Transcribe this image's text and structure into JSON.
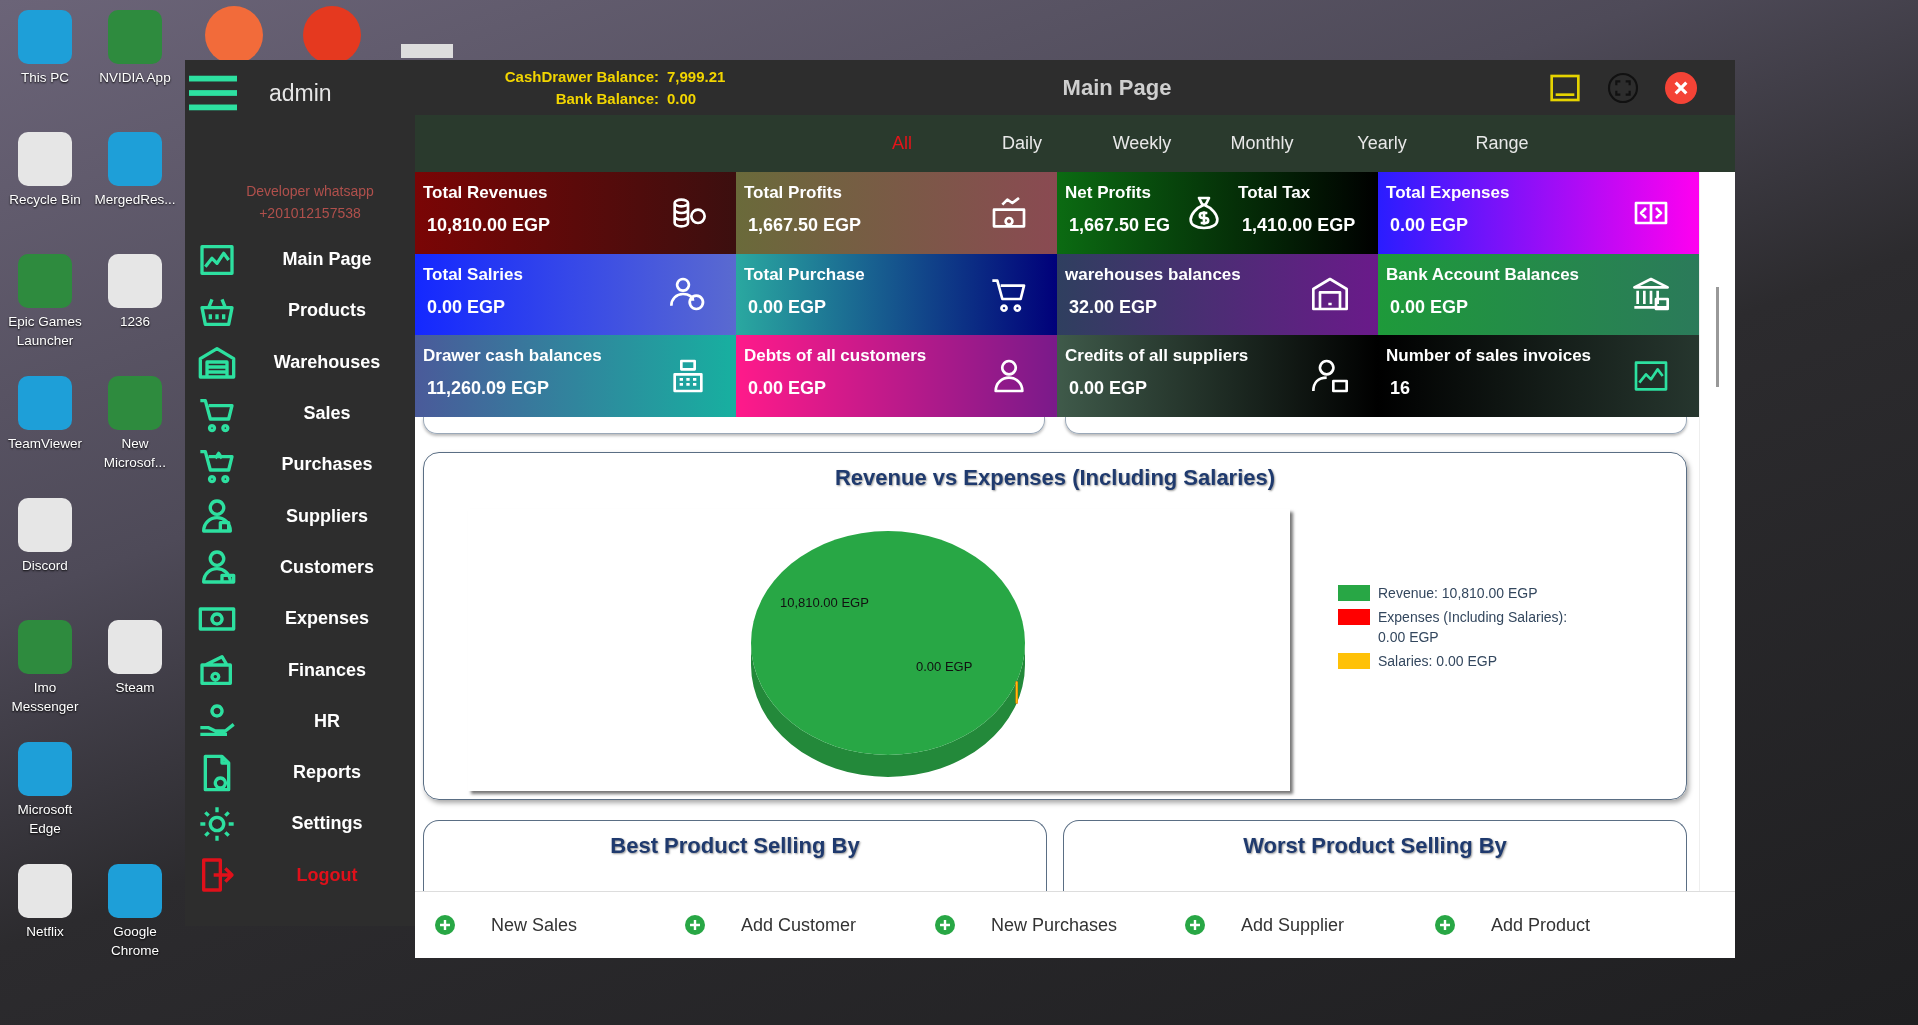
{
  "desktop": {
    "icon_rows": [
      [
        {
          "label": "This PC"
        },
        {
          "label": "NVIDIA App"
        }
      ],
      [
        {
          "label": "Recycle Bin"
        },
        {
          "label": "MergedRes..."
        }
      ],
      [
        {
          "label": "Epic Games Launcher"
        },
        {
          "label": "1236"
        }
      ],
      [
        {
          "label": "TeamViewer"
        },
        {
          "label": "New Microsof..."
        }
      ],
      [
        {
          "label": "Discord"
        }
      ],
      [
        {
          "label": "Imo Messenger"
        },
        {
          "label": "Steam"
        }
      ],
      [
        {
          "label": "Microsoft Edge"
        }
      ],
      [
        {
          "label": "Netflix"
        },
        {
          "label": "Google Chrome"
        }
      ]
    ]
  },
  "sidebar": {
    "user": "admin",
    "developer": [
      "Developer whatsapp",
      "+201012157538"
    ],
    "items": [
      {
        "label": "Main Page",
        "kind": "nav"
      },
      {
        "label": "Products",
        "kind": "nav"
      },
      {
        "label": "Warehouses",
        "kind": "nav"
      },
      {
        "label": "Sales",
        "kind": "nav"
      },
      {
        "label": "Purchases",
        "kind": "nav"
      },
      {
        "label": "Suppliers",
        "kind": "nav"
      },
      {
        "label": "Customers",
        "kind": "nav"
      },
      {
        "label": "Expenses",
        "kind": "nav"
      },
      {
        "label": "Finances",
        "kind": "nav"
      },
      {
        "label": "HR",
        "kind": "nav"
      },
      {
        "label": "Reports",
        "kind": "nav"
      },
      {
        "label": "Settings",
        "kind": "nav"
      },
      {
        "label": "Logout",
        "kind": "logout"
      }
    ]
  },
  "header": {
    "balances": [
      {
        "label": "CashDrawer Balance:",
        "value": "7,999.21"
      },
      {
        "label": "Bank Balance:",
        "value": "0.00"
      }
    ],
    "title": "Main Page"
  },
  "tabs": [
    {
      "label": "All",
      "selected": true
    },
    {
      "label": "Daily",
      "selected": false
    },
    {
      "label": "Weekly",
      "selected": false
    },
    {
      "label": "Monthly",
      "selected": false
    },
    {
      "label": "Yearly",
      "selected": false
    },
    {
      "label": "Range",
      "selected": false
    }
  ],
  "cards": [
    {
      "metrics": [
        {
          "title": "Total Revenues",
          "value": "10,810.00 EGP"
        }
      ]
    },
    {
      "metrics": [
        {
          "title": "Total Profits",
          "value": "1,667.50 EGP"
        }
      ]
    },
    {
      "metrics": [
        {
          "title": "Net Profits",
          "value": "1,667.50 EG"
        },
        {
          "title": "Total Tax",
          "value": "1,410.00 EGP"
        }
      ]
    },
    {
      "metrics": [
        {
          "title": "Total Expenses",
          "value": "0.00 EGP"
        }
      ]
    },
    {
      "metrics": [
        {
          "title": "Total Salries",
          "value": "0.00 EGP"
        }
      ]
    },
    {
      "metrics": [
        {
          "title": "Total Purchase",
          "value": "0.00 EGP"
        }
      ]
    },
    {
      "metrics": [
        {
          "title": "warehouses balances",
          "value": "32.00 EGP"
        }
      ]
    },
    {
      "metrics": [
        {
          "title": "Bank Account Balances",
          "value": "0.00 EGP"
        }
      ]
    },
    {
      "metrics": [
        {
          "title": "Drawer cash balances",
          "value": "11,260.09 EGP"
        }
      ]
    },
    {
      "metrics": [
        {
          "title": "Debts of all customers",
          "value": "0.00 EGP"
        }
      ]
    },
    {
      "metrics": [
        {
          "title": "Credits of all suppliers",
          "value": "0.00 EGP"
        }
      ]
    },
    {
      "metrics": [
        {
          "title": "Number of sales invoices",
          "value": "16"
        }
      ]
    }
  ],
  "chart_panel": {
    "title": "Revenue vs Expenses (Including Salaries)",
    "chart_data": {
      "type": "pie",
      "categories": [
        "Revenue",
        "Expenses (Including Salaries)",
        "Salaries"
      ],
      "values": [
        100,
        0,
        0
      ]
    },
    "slice_labels": [
      "10,810.00 EGP",
      "0.00 EGP"
    ],
    "legend": [
      {
        "separator": ":",
        "amount": "10,810.00 EGP",
        "color": "#28a745"
      },
      {
        "separator": ":",
        "amount": "0.00 EGP",
        "color": "#ff0000"
      },
      {
        "separator": ":",
        "amount": "0.00 EGP",
        "color": "#ffc107"
      }
    ]
  },
  "panels": [
    {
      "title": "Best Product Selling By"
    },
    {
      "title": "Worst Product Selling By"
    }
  ],
  "actions": [
    {
      "label": "New Sales"
    },
    {
      "label": "Add Customer"
    },
    {
      "label": "New Purchases"
    },
    {
      "label": "Add Supplier"
    },
    {
      "label": "Add Product"
    }
  ]
}
